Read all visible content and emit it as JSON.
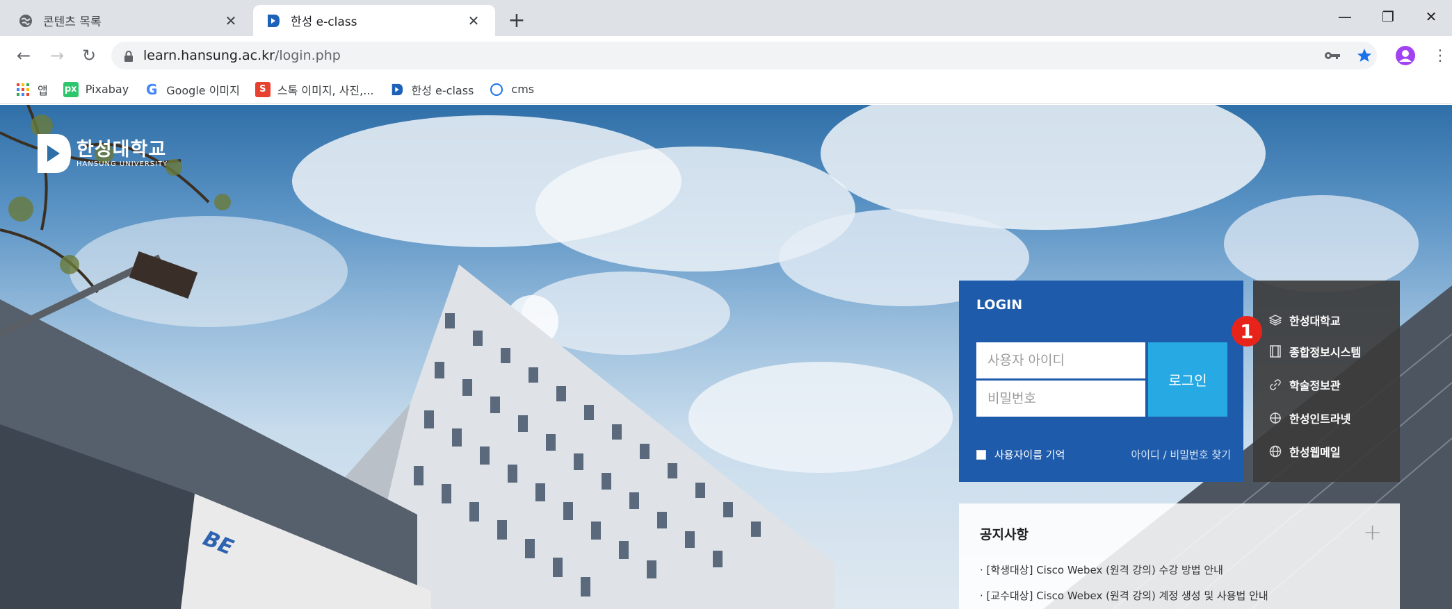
{
  "browser": {
    "tabs": [
      {
        "title": "콘텐츠 목록",
        "active": false
      },
      {
        "title": "한성 e-class",
        "active": true
      }
    ],
    "new_tab_label": "+",
    "window_controls": {
      "minimize": "—",
      "restore": "❐",
      "close": "✕"
    },
    "address": {
      "host": "learn.hansung.ac.kr",
      "path": "/login.php"
    },
    "bookmarks": [
      {
        "label": "앱",
        "icon": "apps-grid-icon"
      },
      {
        "label": "Pixabay",
        "icon": "pixabay-icon"
      },
      {
        "label": "Google 이미지",
        "icon": "google-icon"
      },
      {
        "label": "스톡 이미지, 사진,...",
        "icon": "stock-photo-icon"
      },
      {
        "label": "한성 e-class",
        "icon": "eclass-icon"
      },
      {
        "label": "cms",
        "icon": "cms-circle-icon"
      }
    ]
  },
  "page": {
    "logo": {
      "korean": "한성대학교",
      "english": "HANSUNG UNIVERSITY"
    },
    "login": {
      "title": "LOGIN",
      "id_placeholder": "사용자 아이디",
      "pw_placeholder": "비밀번호",
      "button": "로그인",
      "remember": "사용자이름 기억",
      "find": "아이디 / 비밀번호 찾기"
    },
    "quick_links": [
      {
        "label": "한성대학교",
        "icon": "layers-icon"
      },
      {
        "label": "종합정보시스템",
        "icon": "film-icon"
      },
      {
        "label": "학술정보관",
        "icon": "link-icon"
      },
      {
        "label": "한성인트라넷",
        "icon": "crosshair-icon"
      },
      {
        "label": "한성웹메일",
        "icon": "globe-icon"
      }
    ],
    "badge": "1",
    "notice": {
      "title": "공지사항",
      "more": "+",
      "items": [
        "· [학생대상] Cisco Webex (원격 강의) 수강 방법 안내",
        "· [교수대상] Cisco Webex (원격 강의) 계정 생성 및 사용법 안내"
      ]
    }
  },
  "colors": {
    "login_bg": "#1f5bab",
    "login_button": "#27aae3",
    "badge": "#e8231a"
  }
}
